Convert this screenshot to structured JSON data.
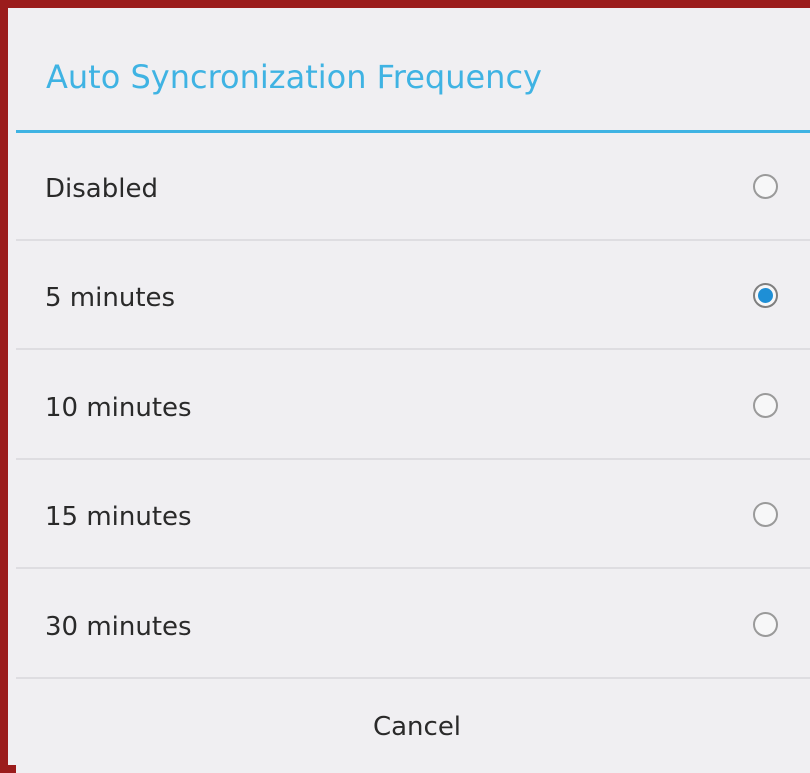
{
  "dialog": {
    "title": "Auto Syncronization Frequency",
    "accent_color": "#3fb3e3",
    "frame_color": "#9b1c1c",
    "options": [
      {
        "label": "Disabled",
        "selected": false
      },
      {
        "label": "5 minutes",
        "selected": true
      },
      {
        "label": "10 minutes",
        "selected": false
      },
      {
        "label": "15 minutes",
        "selected": false
      },
      {
        "label": "30 minutes",
        "selected": false
      }
    ],
    "cancel_label": "Cancel"
  }
}
